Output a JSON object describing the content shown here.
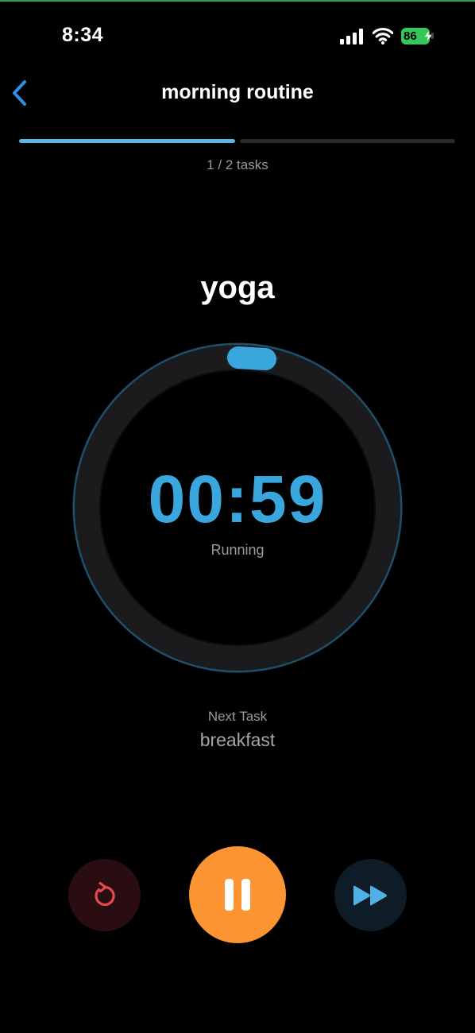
{
  "status_bar": {
    "time": "8:34",
    "battery": "86"
  },
  "nav": {
    "title": "morning routine",
    "back_icon": "chevron-left-icon"
  },
  "progress": {
    "text": "1 / 2 tasks",
    "completed": 1,
    "total": 2
  },
  "task": {
    "name": "yoga",
    "timer": "00:59",
    "status": "Running"
  },
  "next_task": {
    "label": "Next Task",
    "name": "breakfast"
  },
  "controls": {
    "restart_icon": "restart-icon",
    "pause_icon": "pause-icon",
    "skip_icon": "fast-forward-icon"
  },
  "colors": {
    "accent": "#3aa6de",
    "progress_fill": "#5ab4e8",
    "pause_button": "#fd9432",
    "restart_icon": "#e5484d",
    "battery": "#34c759"
  }
}
